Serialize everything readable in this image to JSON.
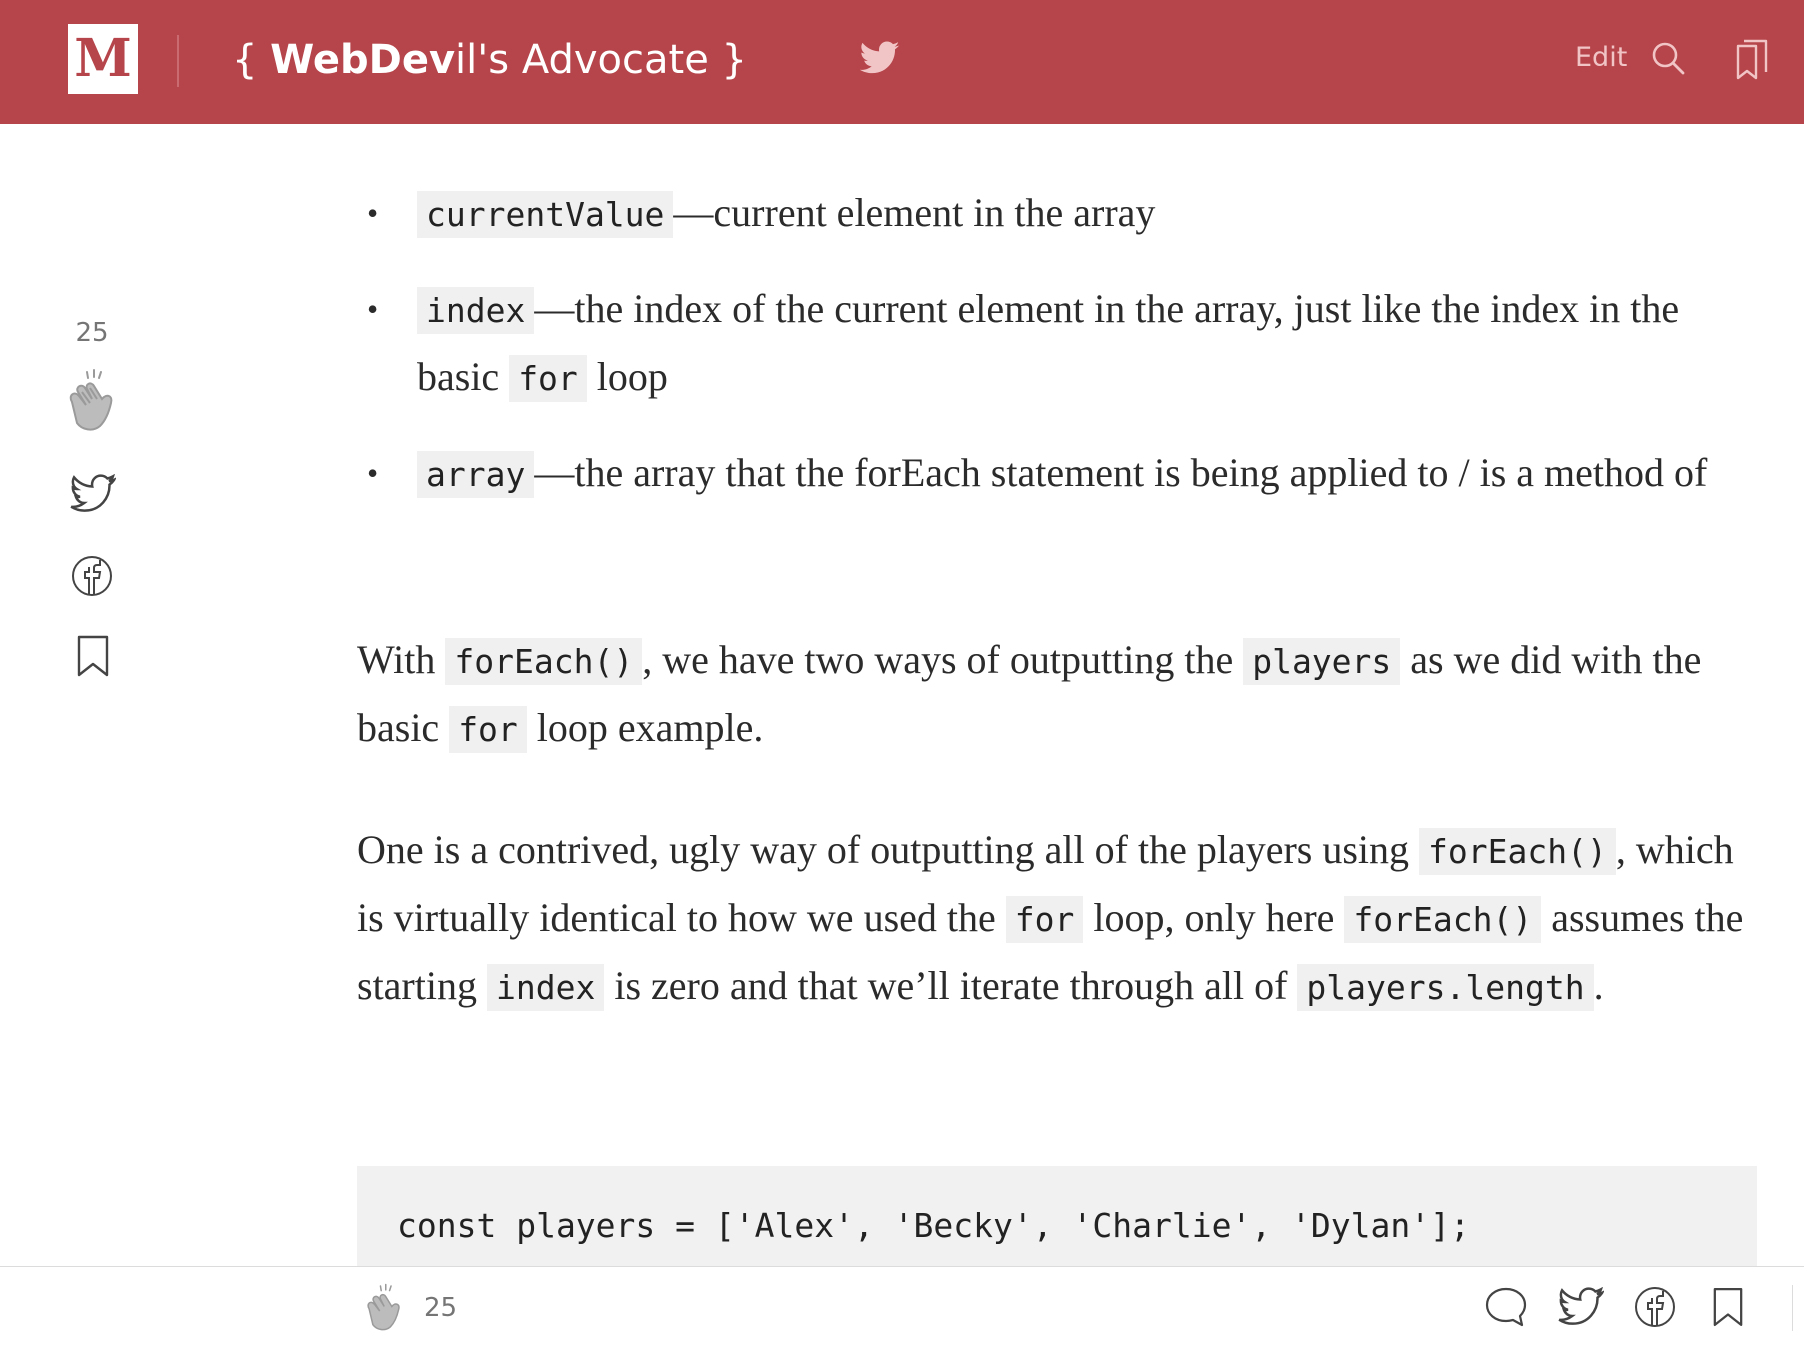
{
  "header": {
    "logo_letter": "M",
    "publication": {
      "open_brace": "{",
      "bold_part": "WebDev",
      "light_part": "il's Advocate",
      "close_brace": "}"
    },
    "edit_label": "Edit",
    "accent_color": "#b5454a",
    "icons": [
      "twitter-icon",
      "search-icon",
      "bookmarks-icon"
    ]
  },
  "rail": {
    "clap_count": "25",
    "icons": [
      "clap-icon",
      "twitter-icon",
      "facebook-icon",
      "bookmark-icon"
    ]
  },
  "article": {
    "bullets": [
      {
        "code": "currentValue",
        "text": "—current element in the array"
      },
      {
        "code": "index",
        "text_before": "—the index of the current element in the array, just like the index in the basic ",
        "code2": "for",
        "text_after": " loop"
      },
      {
        "code": "array",
        "text": "—the array that the forEach statement is being applied to / is a method of"
      }
    ],
    "paragraph1": {
      "t1": "With ",
      "c1": "forEach()",
      "t2": ", we have two ways of outputting the ",
      "c2": "players",
      "t3": " as we did with the basic ",
      "c3": "for",
      "t4": " loop example."
    },
    "paragraph2": {
      "t1": "One is a contrived, ugly way of outputting all of the players using ",
      "c1": "forEach()",
      "t2": ", which is virtually identical to how we used the ",
      "c2": "for",
      "t3": " loop, only here ",
      "c3": "forEach()",
      "t4": " assumes the starting ",
      "c4": "index",
      "t5": " is zero and that we’ll iterate through all of ",
      "c5": "players.length",
      "t6": "."
    },
    "code_block": {
      "line1": "const players = ['Alex', 'Becky', 'Charlie', 'Dylan'];"
    }
  },
  "bottom_bar": {
    "clap_count": "25",
    "icons": [
      "clap-icon",
      "comment-icon",
      "twitter-icon",
      "facebook-icon",
      "bookmark-icon"
    ]
  }
}
